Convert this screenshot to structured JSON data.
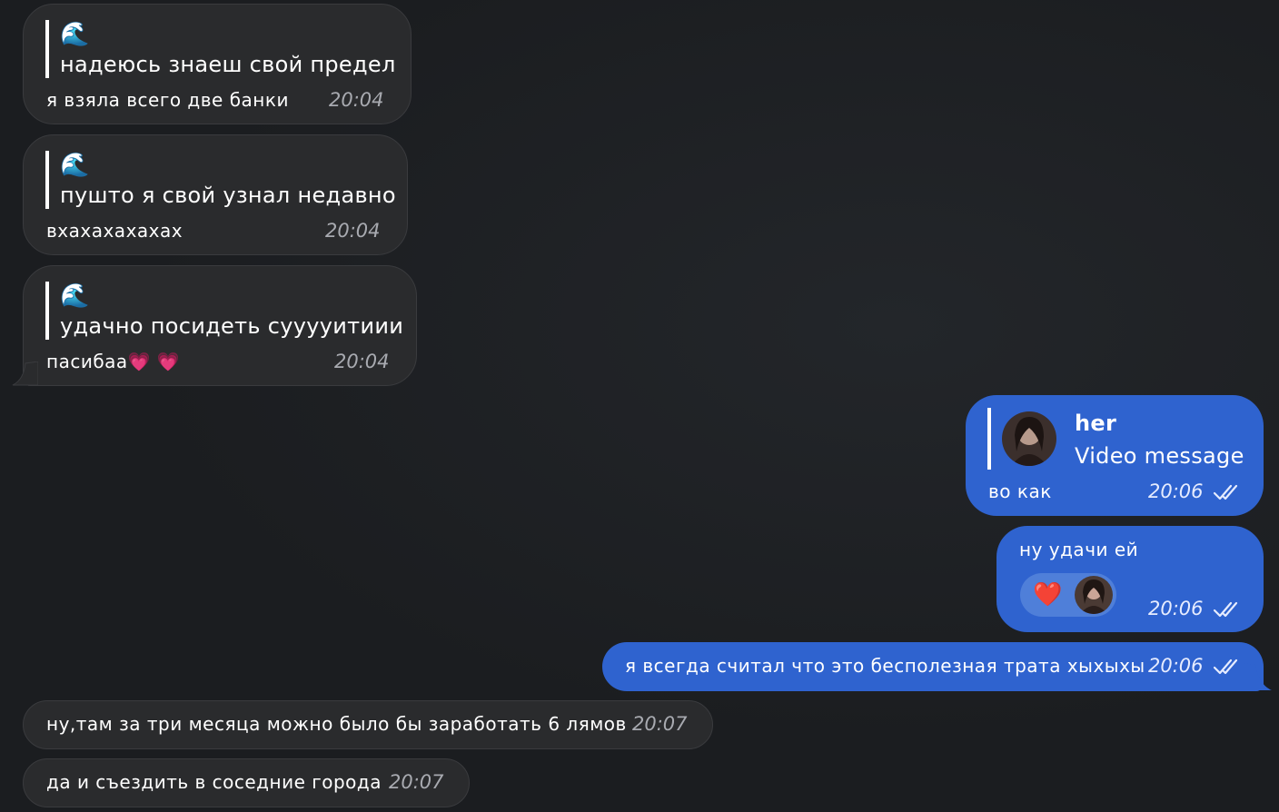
{
  "colors": {
    "background": "#1b1d20",
    "incoming_bubble": "#2a2b2d",
    "outgoing_bubble": "#2f63cf"
  },
  "messages": [
    {
      "quote_emoji": "🌊",
      "quote_text": "надеюсь знаеш свой предел",
      "text": "я взяла всего две банки",
      "time": "20:04"
    },
    {
      "quote_emoji": "🌊",
      "quote_text": "пушто я свой узнал недавно",
      "text": "вхахахахахах",
      "time": "20:04"
    },
    {
      "quote_emoji": "🌊",
      "quote_text": "удачно посидеть сууууитиии",
      "text": "пасибаа💗 💗",
      "time": "20:04"
    },
    {
      "quote_author": "her",
      "quote_text": "Video message",
      "text": "во как",
      "time": "20:06"
    },
    {
      "text": "ну удачи ей",
      "reaction": "❤️",
      "time": "20:06"
    },
    {
      "text": "я всегда считал что это бесполезная трата хыхыхы",
      "time": "20:06"
    },
    {
      "text": "ну,там за три месяца можно было бы заработать 6 лямов",
      "time": "20:07"
    },
    {
      "text": "да и съездить в соседние города",
      "time": "20:07"
    }
  ]
}
